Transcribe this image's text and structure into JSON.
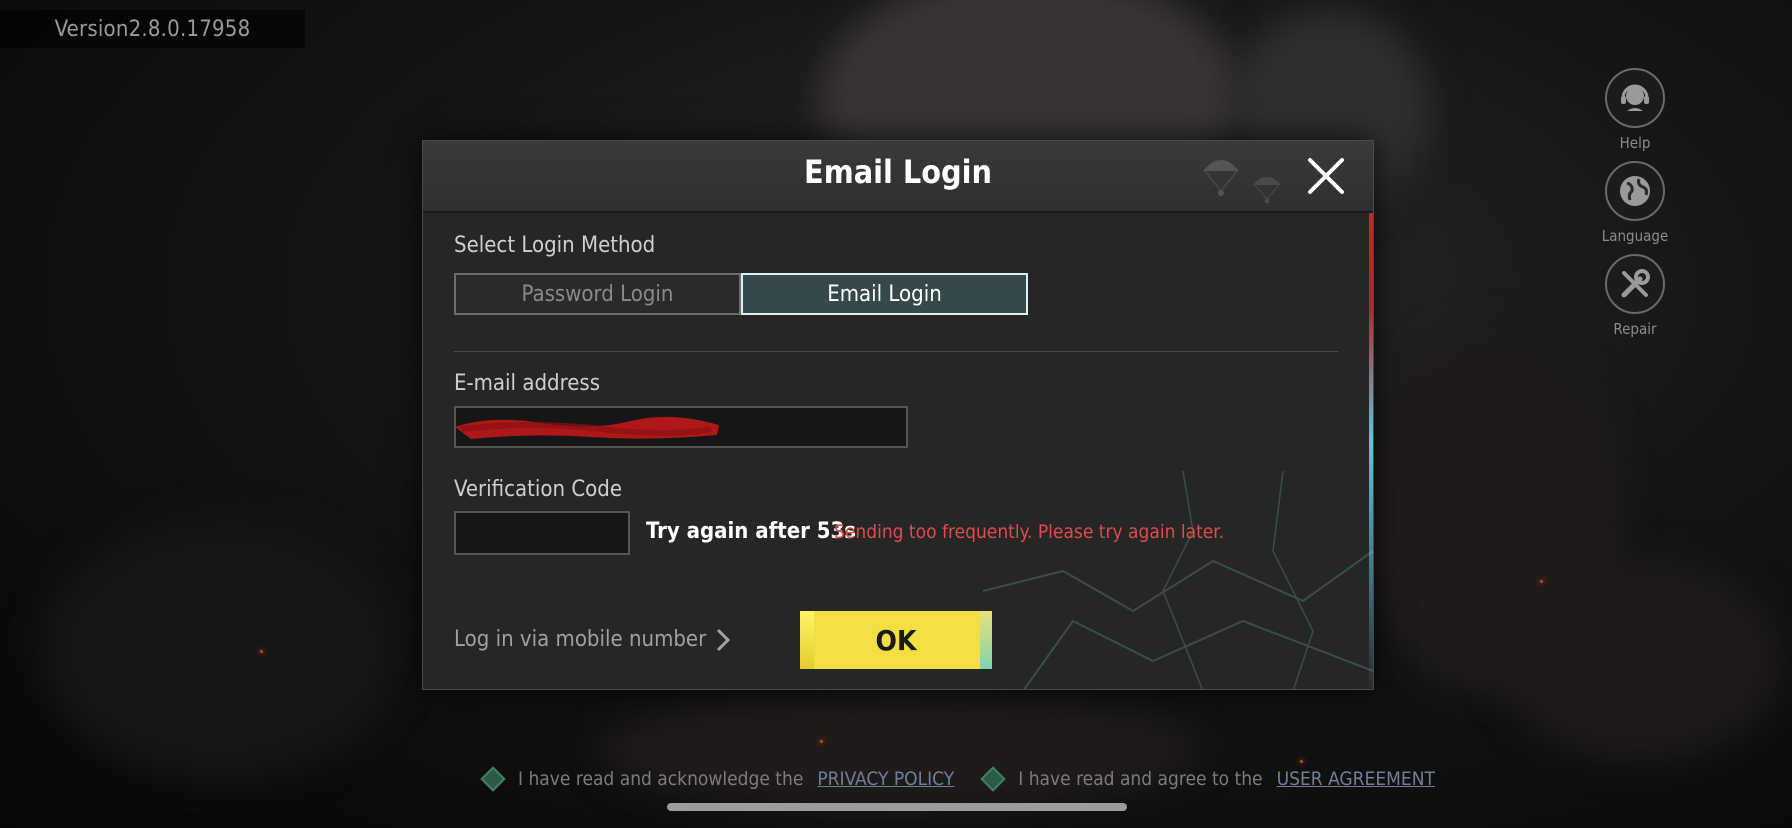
{
  "version": "Version2.8.0.17958",
  "side_menu": [
    {
      "label": "Help",
      "icon": "help-icon"
    },
    {
      "label": "Language",
      "icon": "globe-icon"
    },
    {
      "label": "Repair",
      "icon": "repair-icon"
    }
  ],
  "dialog": {
    "title": "Email Login",
    "close_icon": "close-icon",
    "method_label": "Select Login Method",
    "tabs": [
      {
        "label": "Password Login",
        "active": false
      },
      {
        "label": "Email Login",
        "active": true
      }
    ],
    "email_label": "E-mail address",
    "email_value": "",
    "code_label": "Verification Code",
    "code_value": "",
    "retry_text": "Try again after 53s",
    "error_text": "Sending too frequently. Please try again later.",
    "mobile_link": "Log in via mobile number",
    "ok_label": "OK"
  },
  "footer": {
    "privacy_prefix": "I have read and acknowledge the",
    "privacy_link": "PRIVACY POLICY",
    "agreement_prefix": "I have read and agree to the",
    "agreement_link": "USER AGREEMENT"
  },
  "colors": {
    "accent_yellow": "#f3df44",
    "error_red": "#e14b4b",
    "active_tab_border": "#d9f3f3",
    "checkbox_green": "#2d5a45"
  }
}
